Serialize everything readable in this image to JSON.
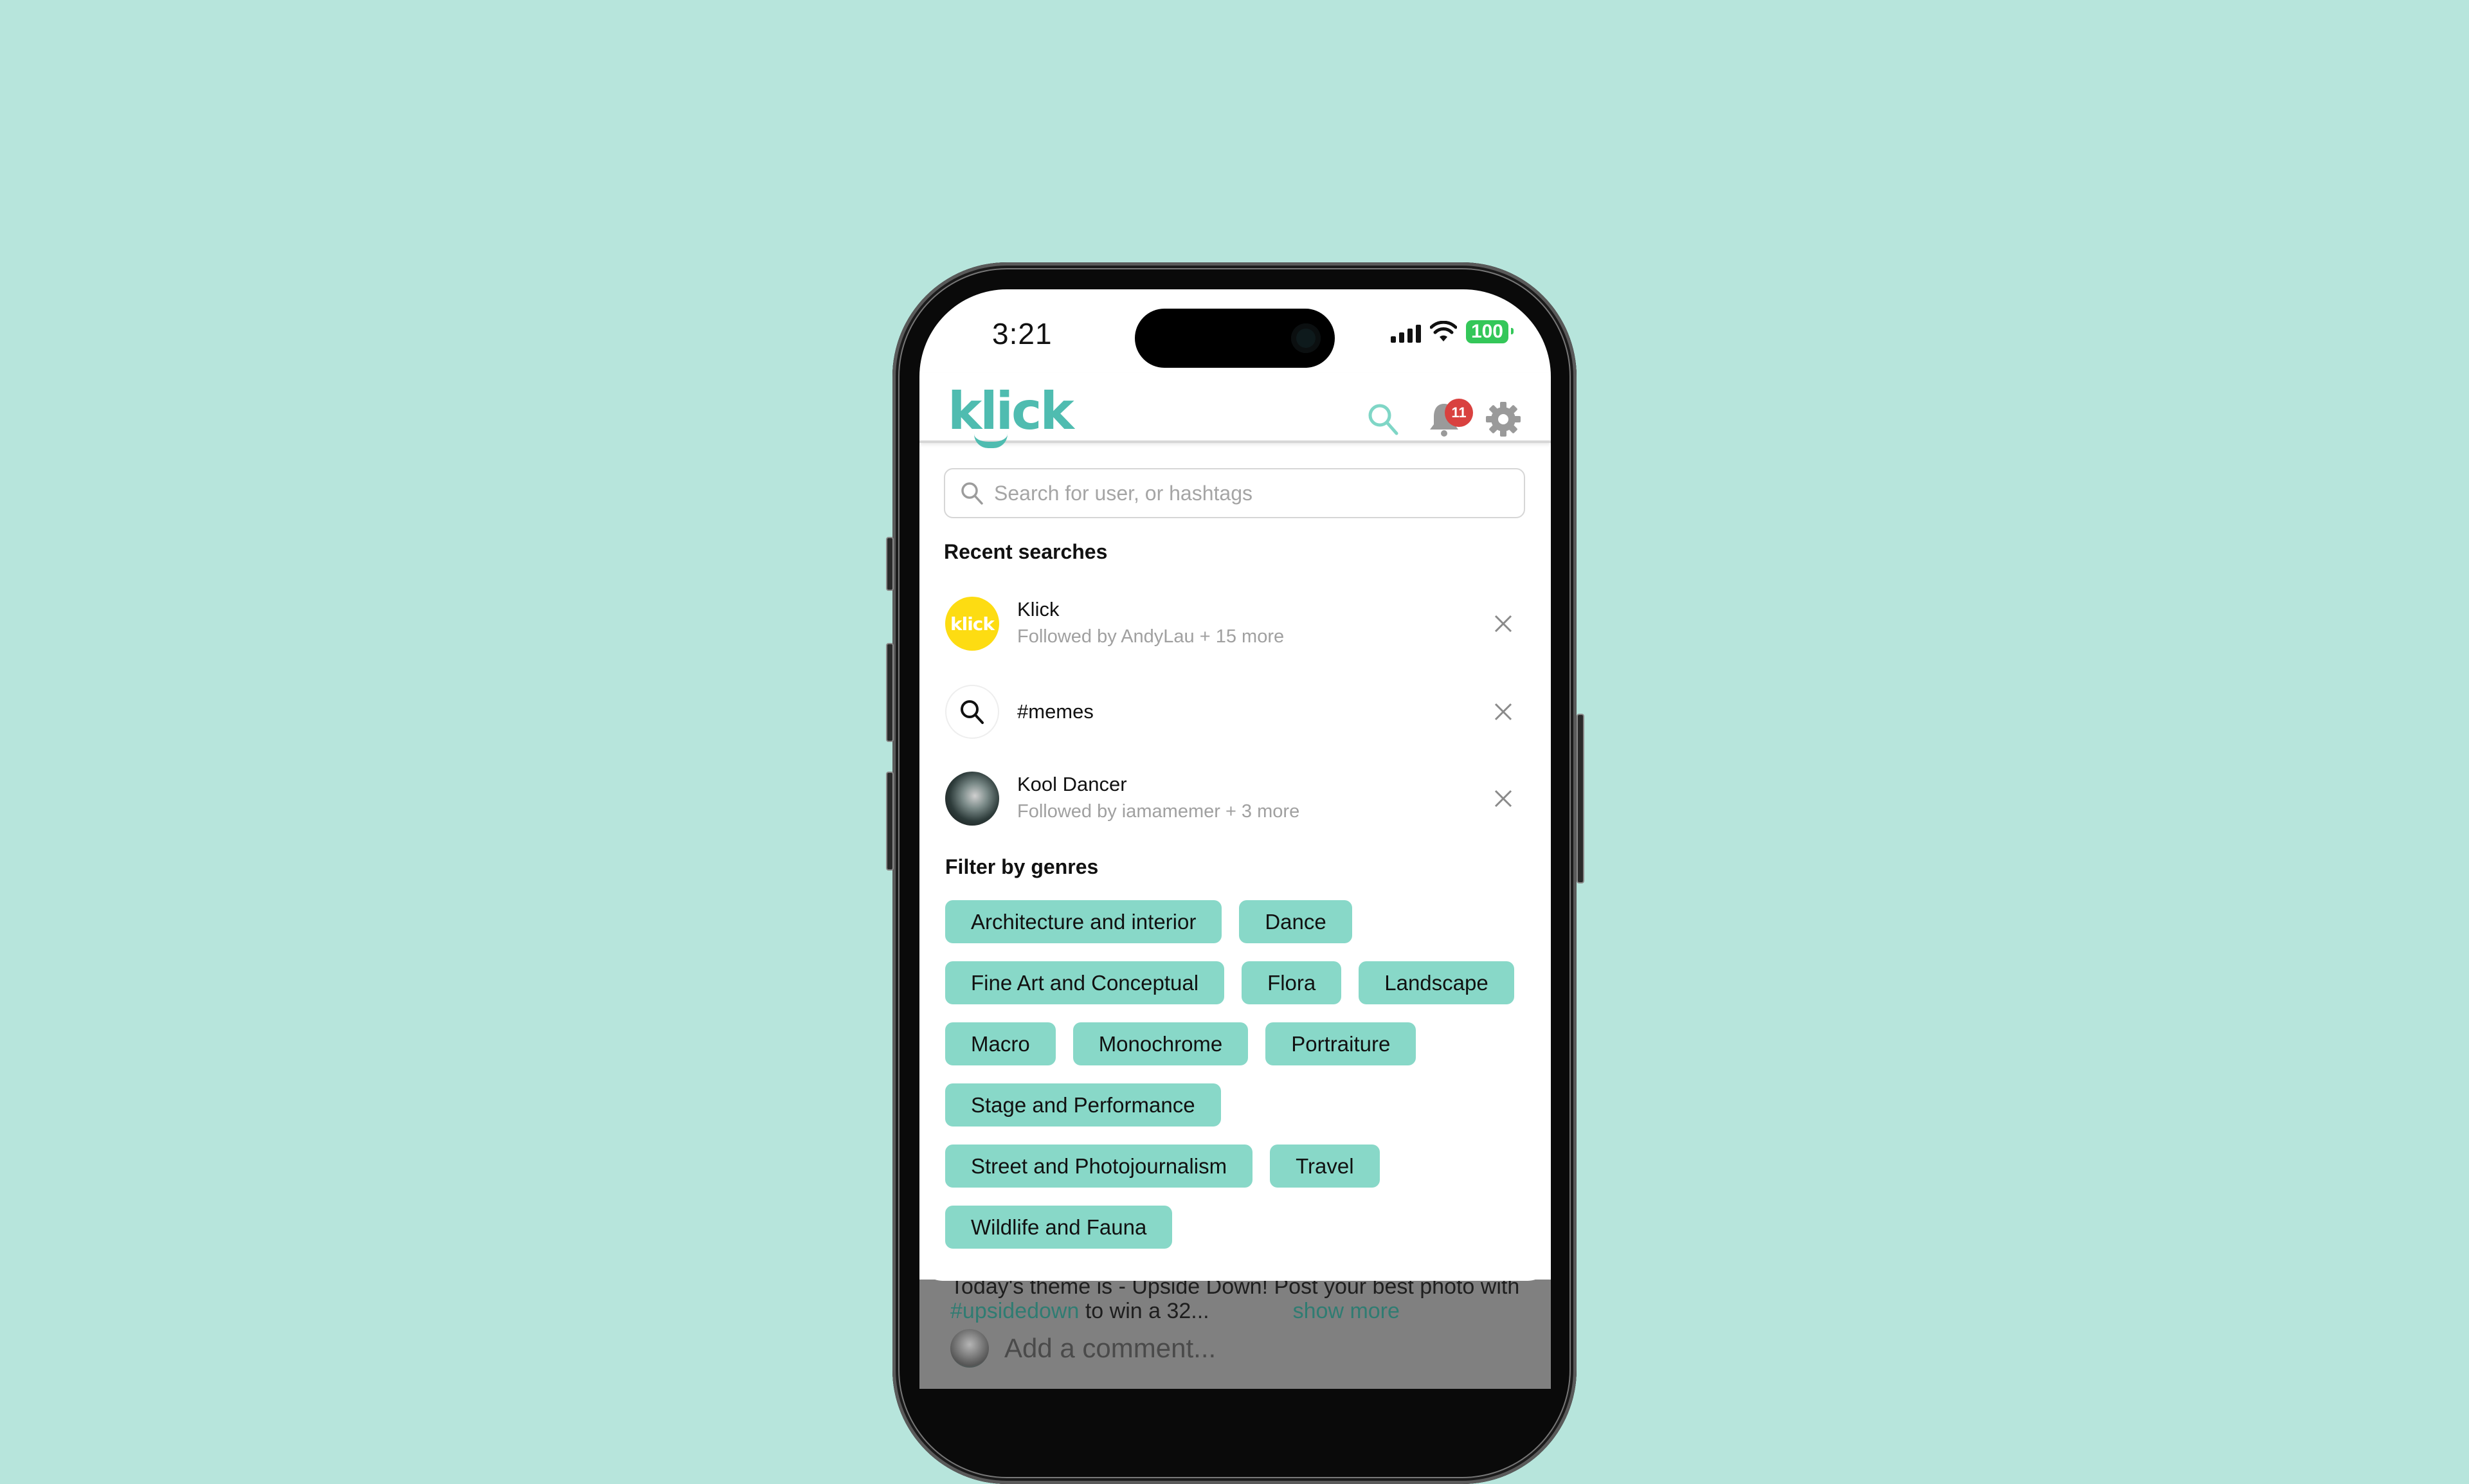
{
  "status_bar": {
    "time": "3:21",
    "battery": "100"
  },
  "header": {
    "logo": "klick",
    "notification_count": "11",
    "icons": [
      "search-icon",
      "bell-icon",
      "gear-icon"
    ]
  },
  "search": {
    "placeholder": "Search for user, or hashtags",
    "value": ""
  },
  "recent": {
    "title": "Recent searches",
    "items": [
      {
        "title": "Klick",
        "subtitle": "Followed by AndyLau + 15 more",
        "avatar": "klick",
        "avatar_text": "klick"
      },
      {
        "title": "#memes",
        "subtitle": "",
        "avatar": "search-icon"
      },
      {
        "title": "Kool Dancer",
        "subtitle": "Followed by iamamemer + 3 more",
        "avatar": "photo"
      }
    ]
  },
  "genres": {
    "title": "Filter by genres",
    "rows": [
      [
        "Architecture and interior",
        "Dance"
      ],
      [
        "Fine Art and Conceptual",
        "Flora",
        "Landscape"
      ],
      [
        "Macro",
        "Monochrome",
        "Portraiture"
      ],
      [
        "Stage and Performance"
      ],
      [
        "Street and Photojournalism",
        "Travel"
      ],
      [
        "Wildlife and Fauna"
      ]
    ]
  },
  "background_post": {
    "line1": "Today's theme is - Upside Down! Post your best photo with",
    "hashtag": "#upsidedown",
    "line2_rest": " to win a 32...",
    "show_more": "show more",
    "comment_placeholder": "Add a comment..."
  },
  "colors": {
    "background": "#b7e5dc",
    "brand": "#4fbcb0",
    "chip": "#88d8c8",
    "badge": "#d9413f",
    "battery": "#34c759"
  }
}
